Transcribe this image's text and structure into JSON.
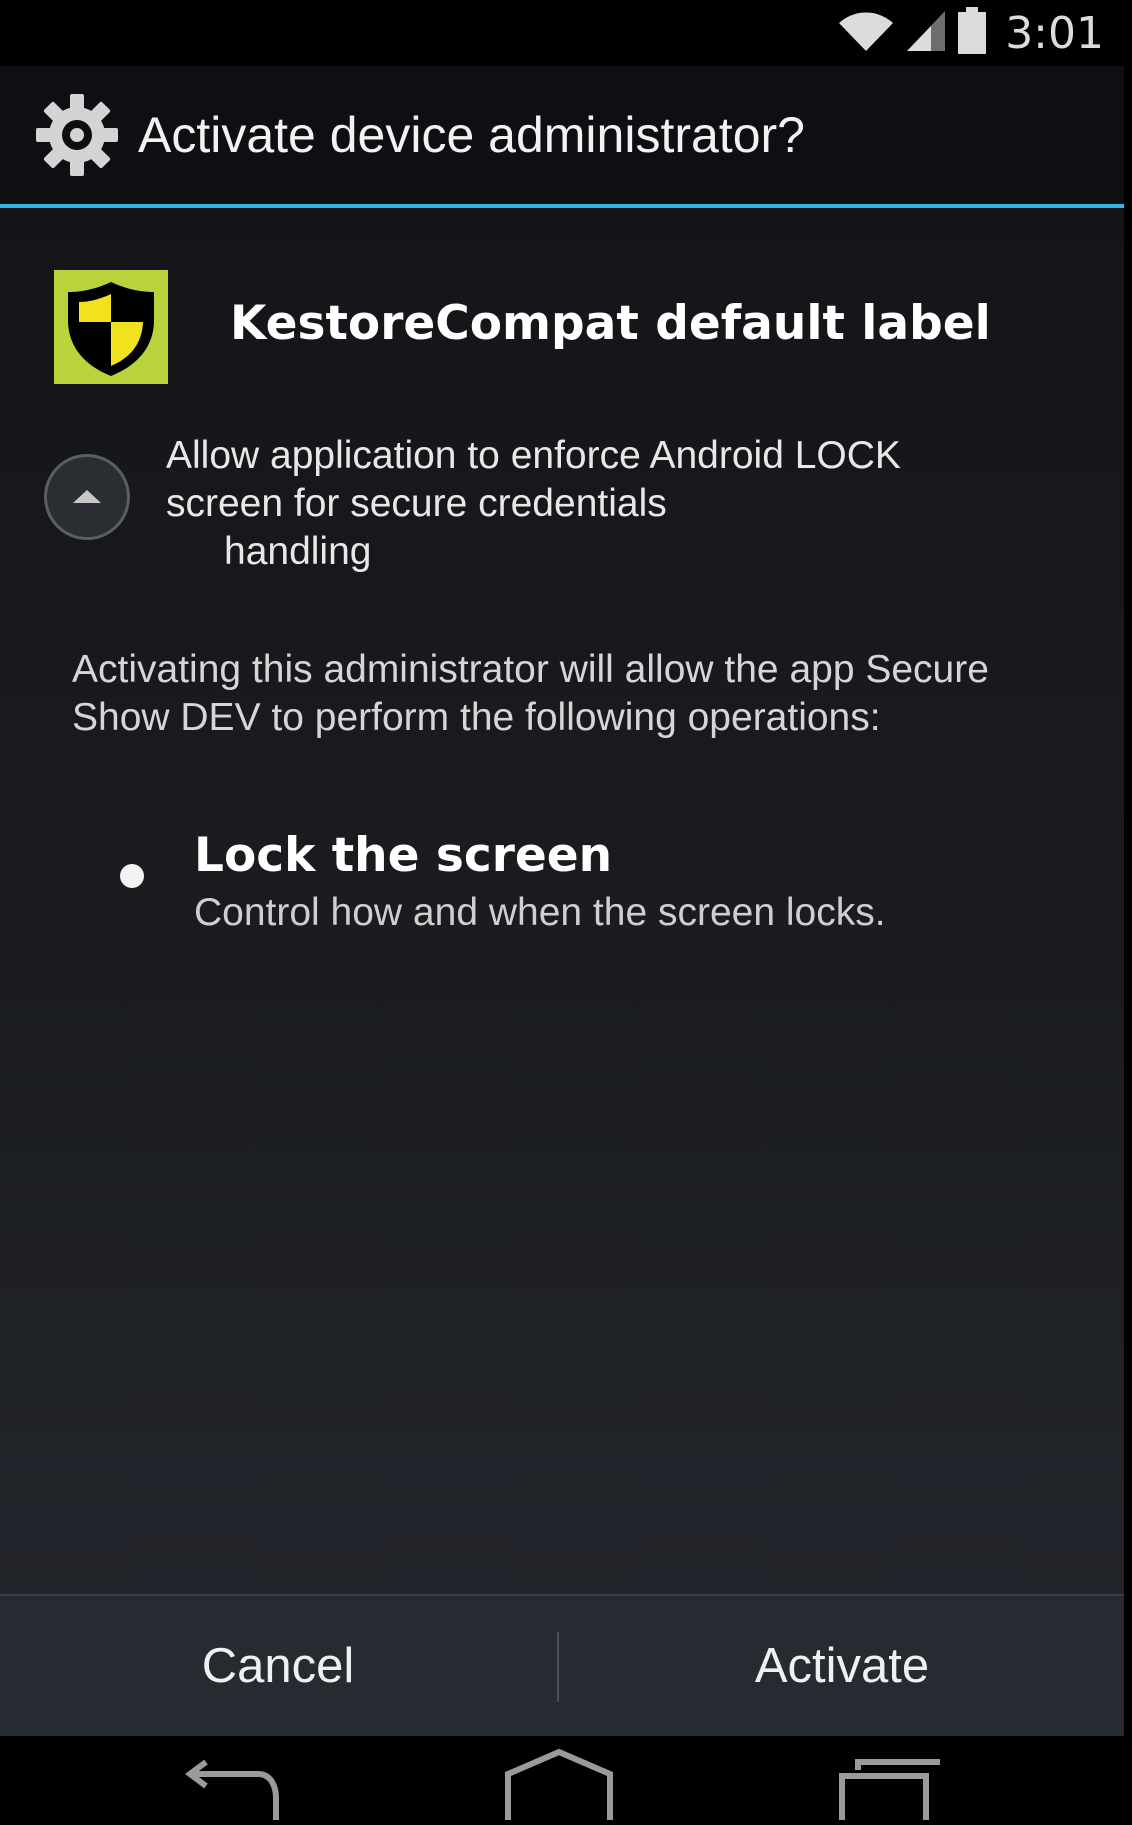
{
  "status_bar": {
    "time": "3:01",
    "icons": [
      "wifi-icon",
      "cell-signal-icon",
      "battery-icon"
    ]
  },
  "dialog": {
    "title": "Activate device administrator?",
    "title_icon": "gear-icon"
  },
  "app": {
    "name": "KestoreCompat default label",
    "icon": "shield-icon"
  },
  "admin_description": {
    "line1": "Allow application to enforce Android LOCK screen for secure credentials",
    "line2": "handling"
  },
  "activating_text": "Activating this administrator will allow the app Secure Show DEV to perform the following operations:",
  "policies": [
    {
      "title": "Lock the screen",
      "description": "Control how and when the screen locks."
    }
  ],
  "buttons": {
    "cancel": "Cancel",
    "activate": "Activate"
  },
  "nav_bar": {
    "icons": [
      "back-icon",
      "home-icon",
      "recents-icon"
    ]
  },
  "colors": {
    "accent": "#33b5e5",
    "app_icon_bg": "#b8d43a",
    "shield_yellow": "#f0e31e"
  }
}
